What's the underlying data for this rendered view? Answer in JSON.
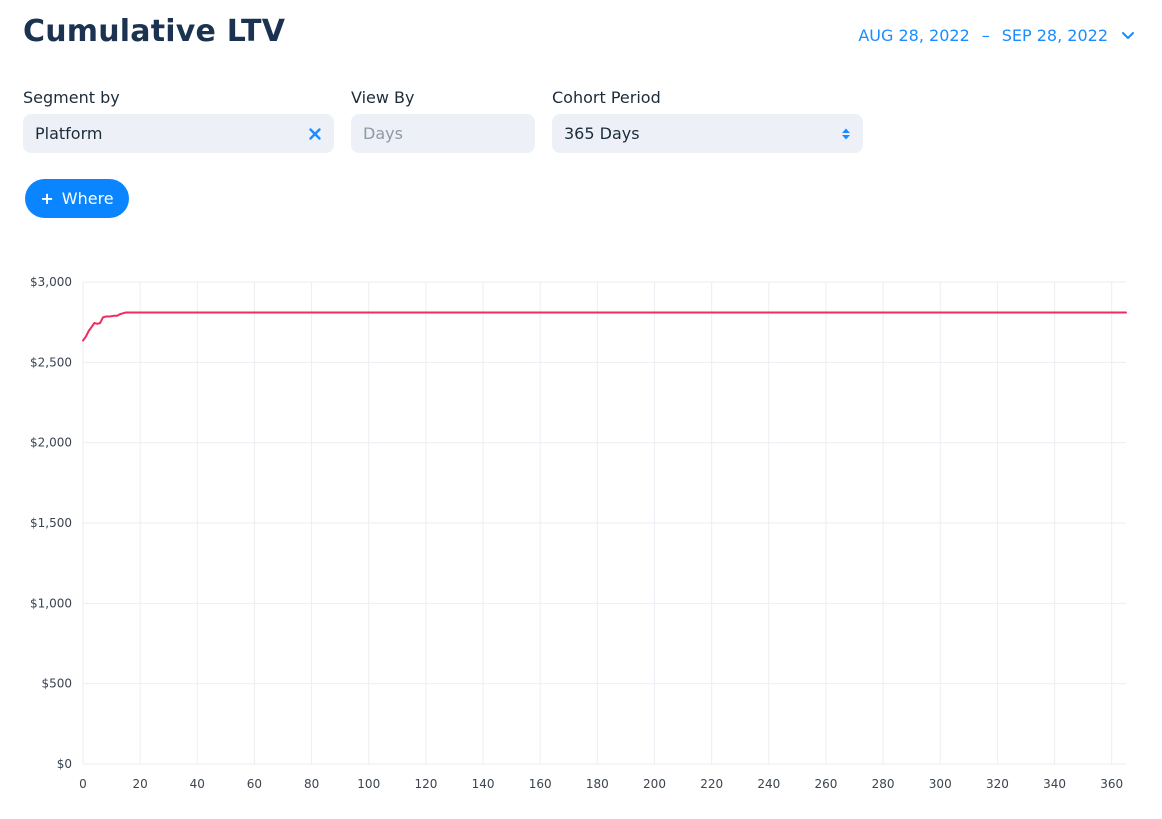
{
  "header": {
    "title": "Cumulative LTV",
    "date_start": "AUG 28, 2022",
    "date_separator": "–",
    "date_end": "SEP 28, 2022"
  },
  "filters": {
    "segment_by": {
      "label": "Segment by",
      "value": "Platform"
    },
    "view_by": {
      "label": "View By",
      "value": "Days"
    },
    "cohort_period": {
      "label": "Cohort Period",
      "value": "365 Days"
    }
  },
  "where_button": {
    "label": "Where"
  },
  "colors": {
    "line": "#ef2b5f",
    "accent": "#0a84ff",
    "grid": "#ebeef2"
  },
  "chart_data": {
    "type": "line",
    "title": "",
    "xlabel": "",
    "ylabel": "",
    "xlim": [
      0,
      365
    ],
    "ylim": [
      0,
      3000
    ],
    "grid": true,
    "x_ticks": [
      0,
      20,
      40,
      60,
      80,
      100,
      120,
      140,
      160,
      180,
      200,
      220,
      240,
      260,
      280,
      300,
      320,
      340,
      360
    ],
    "y_ticks": [
      {
        "value": 0,
        "label": "$0"
      },
      {
        "value": 500,
        "label": "$500"
      },
      {
        "value": 1000,
        "label": "$1,000"
      },
      {
        "value": 1500,
        "label": "$1,500"
      },
      {
        "value": 2000,
        "label": "$2,000"
      },
      {
        "value": 2500,
        "label": "$2,500"
      },
      {
        "value": 3000,
        "label": "$3,000"
      }
    ],
    "series": [
      {
        "x": [
          0,
          1,
          2,
          3,
          4,
          5,
          6,
          7,
          8,
          9,
          10,
          11,
          12,
          13,
          14,
          15,
          20,
          40,
          60,
          100,
          200,
          300,
          365
        ],
        "y": [
          2635,
          2660,
          2695,
          2720,
          2745,
          2740,
          2745,
          2780,
          2785,
          2785,
          2787,
          2790,
          2790,
          2800,
          2805,
          2810,
          2810,
          2810,
          2810,
          2810,
          2810,
          2810,
          2810
        ]
      }
    ]
  }
}
